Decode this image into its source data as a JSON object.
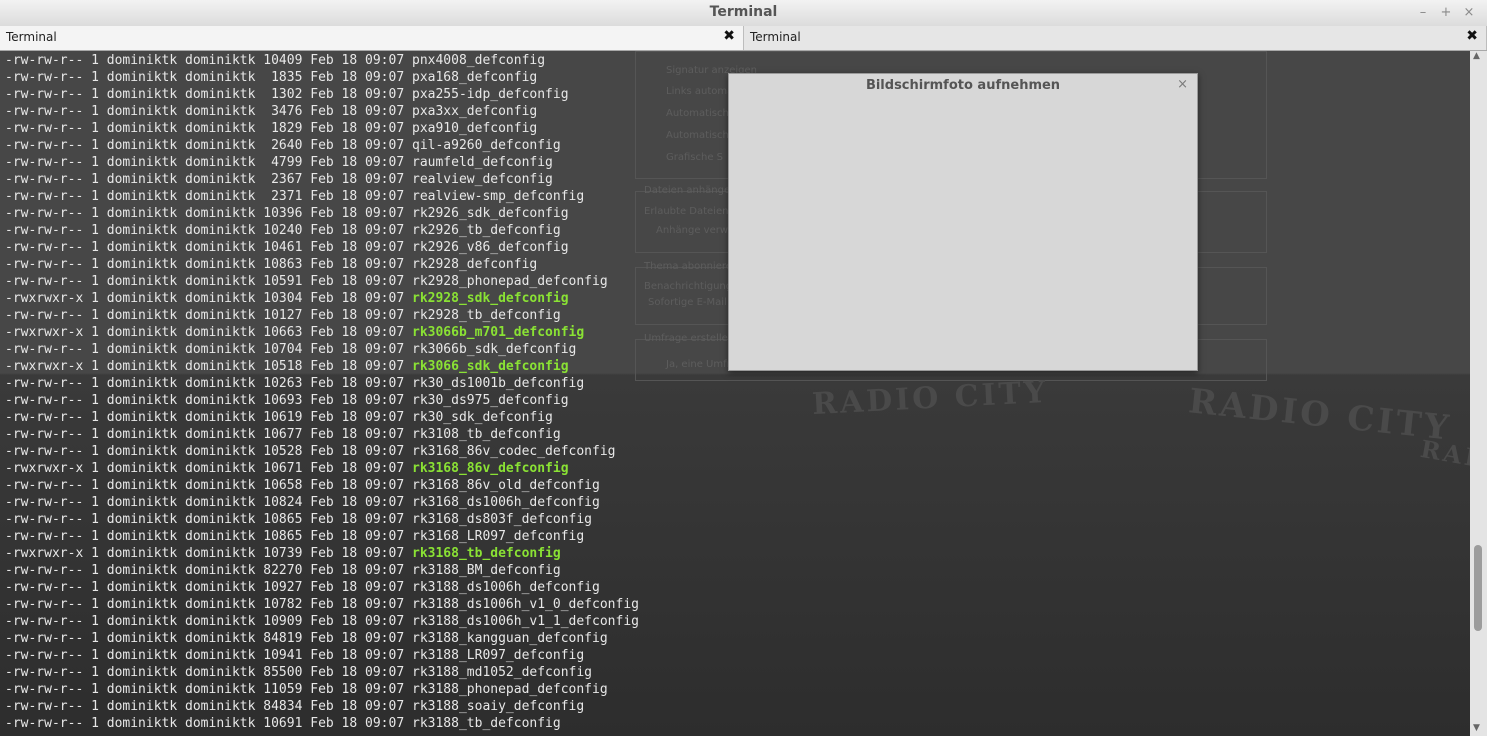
{
  "window": {
    "title": "Terminal",
    "controls": {
      "minimize": "–",
      "maximize": "+",
      "close": "×"
    }
  },
  "tabs": [
    {
      "label": "Terminal",
      "close": "✖"
    },
    {
      "label": "Terminal",
      "close": "✖"
    }
  ],
  "dialog": {
    "title": "Bildschirmfoto aufnehmen",
    "close": "×"
  },
  "background": {
    "form_labels": [
      "Signatur anzeigen",
      "Links automatisch",
      "Automatisch",
      "Automatisch",
      "Grafische S",
      "Dateien anhängen",
      "Erlaubte Dateiendungen",
      "Anhänge verwalten",
      "Thema abonnieren",
      "Benachrichtigung",
      "Sofortige E-Mail",
      "Umfrage erstellen",
      "Ja, eine Umfrage"
    ],
    "sign_text": [
      "RADIO CITY",
      "RADIO CITY",
      "RADIO"
    ]
  },
  "colors": {
    "terminal_text": "#e8e8e8",
    "exec_green": "#8ae234"
  },
  "terminal": {
    "lines": [
      {
        "perms": "-rw-rw-r--",
        "links": "1",
        "user": "dominiktk",
        "group": "dominiktk",
        "size": "10409",
        "date": "Feb 18 09:07",
        "name": "pnx4008_defconfig",
        "exec": false
      },
      {
        "perms": "-rw-rw-r--",
        "links": "1",
        "user": "dominiktk",
        "group": "dominiktk",
        "size": "1835",
        "date": "Feb 18 09:07",
        "name": "pxa168_defconfig",
        "exec": false
      },
      {
        "perms": "-rw-rw-r--",
        "links": "1",
        "user": "dominiktk",
        "group": "dominiktk",
        "size": "1302",
        "date": "Feb 18 09:07",
        "name": "pxa255-idp_defconfig",
        "exec": false
      },
      {
        "perms": "-rw-rw-r--",
        "links": "1",
        "user": "dominiktk",
        "group": "dominiktk",
        "size": "3476",
        "date": "Feb 18 09:07",
        "name": "pxa3xx_defconfig",
        "exec": false
      },
      {
        "perms": "-rw-rw-r--",
        "links": "1",
        "user": "dominiktk",
        "group": "dominiktk",
        "size": "1829",
        "date": "Feb 18 09:07",
        "name": "pxa910_defconfig",
        "exec": false
      },
      {
        "perms": "-rw-rw-r--",
        "links": "1",
        "user": "dominiktk",
        "group": "dominiktk",
        "size": "2640",
        "date": "Feb 18 09:07",
        "name": "qil-a9260_defconfig",
        "exec": false
      },
      {
        "perms": "-rw-rw-r--",
        "links": "1",
        "user": "dominiktk",
        "group": "dominiktk",
        "size": "4799",
        "date": "Feb 18 09:07",
        "name": "raumfeld_defconfig",
        "exec": false
      },
      {
        "perms": "-rw-rw-r--",
        "links": "1",
        "user": "dominiktk",
        "group": "dominiktk",
        "size": "2367",
        "date": "Feb 18 09:07",
        "name": "realview_defconfig",
        "exec": false
      },
      {
        "perms": "-rw-rw-r--",
        "links": "1",
        "user": "dominiktk",
        "group": "dominiktk",
        "size": "2371",
        "date": "Feb 18 09:07",
        "name": "realview-smp_defconfig",
        "exec": false
      },
      {
        "perms": "-rw-rw-r--",
        "links": "1",
        "user": "dominiktk",
        "group": "dominiktk",
        "size": "10396",
        "date": "Feb 18 09:07",
        "name": "rk2926_sdk_defconfig",
        "exec": false
      },
      {
        "perms": "-rw-rw-r--",
        "links": "1",
        "user": "dominiktk",
        "group": "dominiktk",
        "size": "10240",
        "date": "Feb 18 09:07",
        "name": "rk2926_tb_defconfig",
        "exec": false
      },
      {
        "perms": "-rw-rw-r--",
        "links": "1",
        "user": "dominiktk",
        "group": "dominiktk",
        "size": "10461",
        "date": "Feb 18 09:07",
        "name": "rk2926_v86_defconfig",
        "exec": false
      },
      {
        "perms": "-rw-rw-r--",
        "links": "1",
        "user": "dominiktk",
        "group": "dominiktk",
        "size": "10863",
        "date": "Feb 18 09:07",
        "name": "rk2928_defconfig",
        "exec": false
      },
      {
        "perms": "-rw-rw-r--",
        "links": "1",
        "user": "dominiktk",
        "group": "dominiktk",
        "size": "10591",
        "date": "Feb 18 09:07",
        "name": "rk2928_phonepad_defconfig",
        "exec": false
      },
      {
        "perms": "-rwxrwxr-x",
        "links": "1",
        "user": "dominiktk",
        "group": "dominiktk",
        "size": "10304",
        "date": "Feb 18 09:07",
        "name": "rk2928_sdk_defconfig",
        "exec": true
      },
      {
        "perms": "-rw-rw-r--",
        "links": "1",
        "user": "dominiktk",
        "group": "dominiktk",
        "size": "10127",
        "date": "Feb 18 09:07",
        "name": "rk2928_tb_defconfig",
        "exec": false
      },
      {
        "perms": "-rwxrwxr-x",
        "links": "1",
        "user": "dominiktk",
        "group": "dominiktk",
        "size": "10663",
        "date": "Feb 18 09:07",
        "name": "rk3066b_m701_defconfig",
        "exec": true
      },
      {
        "perms": "-rw-rw-r--",
        "links": "1",
        "user": "dominiktk",
        "group": "dominiktk",
        "size": "10704",
        "date": "Feb 18 09:07",
        "name": "rk3066b_sdk_defconfig",
        "exec": false
      },
      {
        "perms": "-rwxrwxr-x",
        "links": "1",
        "user": "dominiktk",
        "group": "dominiktk",
        "size": "10518",
        "date": "Feb 18 09:07",
        "name": "rk3066_sdk_defconfig",
        "exec": true
      },
      {
        "perms": "-rw-rw-r--",
        "links": "1",
        "user": "dominiktk",
        "group": "dominiktk",
        "size": "10263",
        "date": "Feb 18 09:07",
        "name": "rk30_ds1001b_defconfig",
        "exec": false
      },
      {
        "perms": "-rw-rw-r--",
        "links": "1",
        "user": "dominiktk",
        "group": "dominiktk",
        "size": "10693",
        "date": "Feb 18 09:07",
        "name": "rk30_ds975_defconfig",
        "exec": false
      },
      {
        "perms": "-rw-rw-r--",
        "links": "1",
        "user": "dominiktk",
        "group": "dominiktk",
        "size": "10619",
        "date": "Feb 18 09:07",
        "name": "rk30_sdk_defconfig",
        "exec": false
      },
      {
        "perms": "-rw-rw-r--",
        "links": "1",
        "user": "dominiktk",
        "group": "dominiktk",
        "size": "10677",
        "date": "Feb 18 09:07",
        "name": "rk3108_tb_defconfig",
        "exec": false
      },
      {
        "perms": "-rw-rw-r--",
        "links": "1",
        "user": "dominiktk",
        "group": "dominiktk",
        "size": "10528",
        "date": "Feb 18 09:07",
        "name": "rk3168_86v_codec_defconfig",
        "exec": false
      },
      {
        "perms": "-rwxrwxr-x",
        "links": "1",
        "user": "dominiktk",
        "group": "dominiktk",
        "size": "10671",
        "date": "Feb 18 09:07",
        "name": "rk3168_86v_defconfig",
        "exec": true
      },
      {
        "perms": "-rw-rw-r--",
        "links": "1",
        "user": "dominiktk",
        "group": "dominiktk",
        "size": "10658",
        "date": "Feb 18 09:07",
        "name": "rk3168_86v_old_defconfig",
        "exec": false
      },
      {
        "perms": "-rw-rw-r--",
        "links": "1",
        "user": "dominiktk",
        "group": "dominiktk",
        "size": "10824",
        "date": "Feb 18 09:07",
        "name": "rk3168_ds1006h_defconfig",
        "exec": false
      },
      {
        "perms": "-rw-rw-r--",
        "links": "1",
        "user": "dominiktk",
        "group": "dominiktk",
        "size": "10865",
        "date": "Feb 18 09:07",
        "name": "rk3168_ds803f_defconfig",
        "exec": false
      },
      {
        "perms": "-rw-rw-r--",
        "links": "1",
        "user": "dominiktk",
        "group": "dominiktk",
        "size": "10865",
        "date": "Feb 18 09:07",
        "name": "rk3168_LR097_defconfig",
        "exec": false
      },
      {
        "perms": "-rwxrwxr-x",
        "links": "1",
        "user": "dominiktk",
        "group": "dominiktk",
        "size": "10739",
        "date": "Feb 18 09:07",
        "name": "rk3168_tb_defconfig",
        "exec": true
      },
      {
        "perms": "-rw-rw-r--",
        "links": "1",
        "user": "dominiktk",
        "group": "dominiktk",
        "size": "82270",
        "date": "Feb 18 09:07",
        "name": "rk3188_BM_defconfig",
        "exec": false
      },
      {
        "perms": "-rw-rw-r--",
        "links": "1",
        "user": "dominiktk",
        "group": "dominiktk",
        "size": "10927",
        "date": "Feb 18 09:07",
        "name": "rk3188_ds1006h_defconfig",
        "exec": false
      },
      {
        "perms": "-rw-rw-r--",
        "links": "1",
        "user": "dominiktk",
        "group": "dominiktk",
        "size": "10782",
        "date": "Feb 18 09:07",
        "name": "rk3188_ds1006h_v1_0_defconfig",
        "exec": false
      },
      {
        "perms": "-rw-rw-r--",
        "links": "1",
        "user": "dominiktk",
        "group": "dominiktk",
        "size": "10909",
        "date": "Feb 18 09:07",
        "name": "rk3188_ds1006h_v1_1_defconfig",
        "exec": false
      },
      {
        "perms": "-rw-rw-r--",
        "links": "1",
        "user": "dominiktk",
        "group": "dominiktk",
        "size": "84819",
        "date": "Feb 18 09:07",
        "name": "rk3188_kangguan_defconfig",
        "exec": false
      },
      {
        "perms": "-rw-rw-r--",
        "links": "1",
        "user": "dominiktk",
        "group": "dominiktk",
        "size": "10941",
        "date": "Feb 18 09:07",
        "name": "rk3188_LR097_defconfig",
        "exec": false
      },
      {
        "perms": "-rw-rw-r--",
        "links": "1",
        "user": "dominiktk",
        "group": "dominiktk",
        "size": "85500",
        "date": "Feb 18 09:07",
        "name": "rk3188_md1052_defconfig",
        "exec": false
      },
      {
        "perms": "-rw-rw-r--",
        "links": "1",
        "user": "dominiktk",
        "group": "dominiktk",
        "size": "11059",
        "date": "Feb 18 09:07",
        "name": "rk3188_phonepad_defconfig",
        "exec": false
      },
      {
        "perms": "-rw-rw-r--",
        "links": "1",
        "user": "dominiktk",
        "group": "dominiktk",
        "size": "84834",
        "date": "Feb 18 09:07",
        "name": "rk3188_soaiy_defconfig",
        "exec": false
      },
      {
        "perms": "-rw-rw-r--",
        "links": "1",
        "user": "dominiktk",
        "group": "dominiktk",
        "size": "10691",
        "date": "Feb 18 09:07",
        "name": "rk3188_tb_defconfig",
        "exec": false
      }
    ]
  }
}
